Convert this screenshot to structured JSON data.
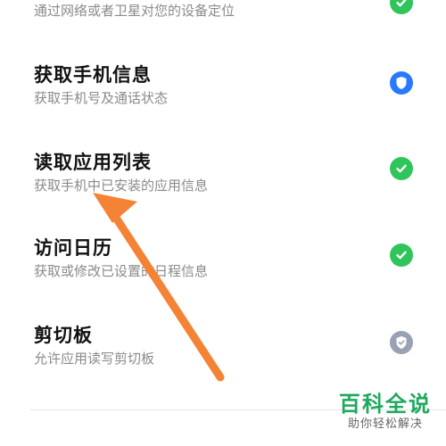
{
  "colors": {
    "check_green": "#2fc55a",
    "shield_blue": "#2979ff",
    "shield_gray": "#9aa1b4",
    "arrow_orange": "#f58336",
    "watermark_green": "#1fa85f"
  },
  "permissions": [
    {
      "title": "",
      "desc": "通过网络或者卫星对您的设备定位",
      "status_icon": "check-icon"
    },
    {
      "title": "获取手机信息",
      "desc": "获取手机号及通话状态",
      "status_icon": "shield-icon"
    },
    {
      "title": "读取应用列表",
      "desc": "获取手机中已安装的应用信息",
      "status_icon": "check-icon"
    },
    {
      "title": "访问日历",
      "desc": "获取或修改已设置的日程信息",
      "status_icon": "check-icon"
    },
    {
      "title": "剪切板",
      "desc": "允许应用读写剪切板",
      "status_icon": "shield-icon"
    }
  ],
  "watermark": {
    "title": "百科全说",
    "subtitle": "助你轻松解决"
  }
}
